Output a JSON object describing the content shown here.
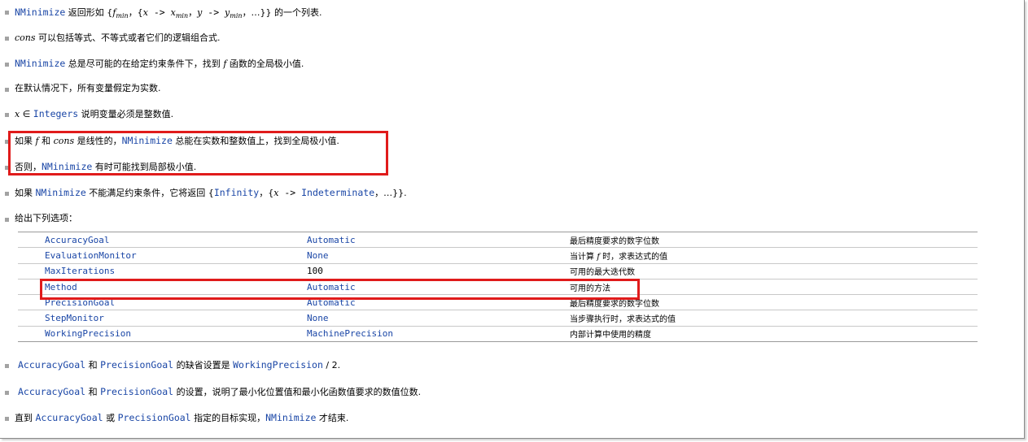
{
  "lines": {
    "l1": {
      "code": "NMinimize",
      "text_a": " 返回形如 {",
      "fmin": "f",
      "fmin_sub": "min",
      "mid": "，{",
      "x": "x",
      "arrow1": " -> ",
      "xmin": "x",
      "xmin_sub": "min",
      "comma": "，",
      "y": "y",
      "arrow2": " -> ",
      "ymin": "y",
      "ymin_sub": "min",
      "tail": "，…}} 的一个列表."
    },
    "l2": {
      "ital": "cons",
      "text": " 可以包括等式、不等式或者它们的逻辑组合式."
    },
    "l3": {
      "code": "NMinimize",
      "text_a": " 总是尽可能的在给定约束条件下，找到 ",
      "f": "f",
      "text_b": " 函数的全局极小值."
    },
    "l4": {
      "text": "在默认情况下，所有变量假定为实数."
    },
    "l5": {
      "x": "x",
      "elem": " ∈ ",
      "code": "Integers",
      "text": " 说明变量必须是整数值."
    },
    "l6": {
      "text_a": "如果 ",
      "f": "f",
      "text_b": " 和 ",
      "cons": "cons",
      "text_c": " 是线性的，",
      "code": "NMinimize",
      "text_d": " 总能在实数和整数值上，找到全局极小值."
    },
    "l7": {
      "text_a": "否则，",
      "code": "NMinimize",
      "text_b": " 有时可能找到局部极小值."
    },
    "l8": {
      "text_a": "如果 ",
      "code": "NMinimize",
      "text_b": " 不能满足约束条件，它将返回 {",
      "code2": "Infinity",
      "text_c": "，{",
      "x": "x",
      "arrow": " -> ",
      "code3": "Indeterminate",
      "text_d": "，…}}."
    },
    "l9": {
      "text": "给出下列选项："
    },
    "l10": {
      "code1": "AccuracyGoal",
      "text_a": " 和 ",
      "code2": "PrecisionGoal",
      "text_b": " 的缺省设置是 ",
      "code3": "WorkingPrecision",
      "text_c": " / 2."
    },
    "l11": {
      "code1": "AccuracyGoal",
      "text_a": " 和 ",
      "code2": "PrecisionGoal",
      "text_b": " 的设置，说明了最小化位置值和最小化函数值要求的数值位数."
    },
    "l12": {
      "text_a": "直到 ",
      "code1": "AccuracyGoal",
      "text_b": " 或 ",
      "code2": "PrecisionGoal",
      "text_c": " 指定的目标实现，",
      "code3": "NMinimize",
      "text_d": " 才结束."
    }
  },
  "options": [
    {
      "name": "AccuracyGoal",
      "value": "Automatic",
      "desc": "最后精度要求的数字位数"
    },
    {
      "name": "EvaluationMonitor",
      "value": "None",
      "desc_a": "当计算 ",
      "desc_f": "f",
      "desc_b": " 时，求表达式的值"
    },
    {
      "name": "MaxIterations",
      "value": "100",
      "desc": "可用的最大迭代数"
    },
    {
      "name": "Method",
      "value": "Automatic",
      "desc": "可用的方法"
    },
    {
      "name": "PrecisionGoal",
      "value": "Automatic",
      "desc": "最后精度要求的数字位数"
    },
    {
      "name": "StepMonitor",
      "value": "None",
      "desc": "当步骤执行时，求表达式的值"
    },
    {
      "name": "WorkingPrecision",
      "value": "MachinePrecision",
      "desc": "内部计算中使用的精度"
    }
  ],
  "colors": {
    "code": "#1a46a6",
    "highlight": "#e01b1b",
    "bullet": "#a3a3a3"
  }
}
